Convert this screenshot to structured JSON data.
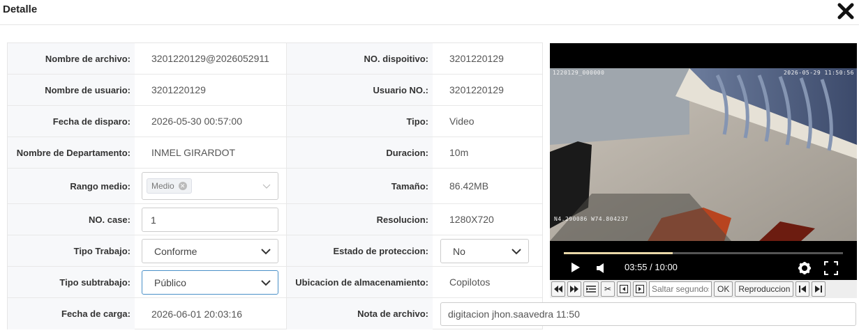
{
  "dialog": {
    "title": "Detalle",
    "close_icon": "close-icon"
  },
  "rows": [
    {
      "label1": "Nombre de archivo:",
      "value1": "3201220129@2026052911",
      "label2": "NO. dispoitivo:",
      "value2": "3201220129"
    },
    {
      "label1": "Nombre de usuario:",
      "value1": "3201220129",
      "label2": "Usuario NO.:",
      "value2": "3201220129"
    },
    {
      "label1": "Fecha de disparo:",
      "value1": "2026-05-30 00:57:00",
      "label2": "Tipo:",
      "value2": "Video"
    },
    {
      "label1": "Nombre de Departamento:",
      "value1": "INMEL GIRARDOT",
      "label2": "Duracion:",
      "value2": "10m"
    },
    {
      "label1": "Rango medio:",
      "value1_tag": "Medio",
      "label2": "Tamaño:",
      "value2": "86.42MB"
    },
    {
      "label1": "NO. case:",
      "value1_input": "1",
      "label2": "Resolucion:",
      "value2": "1280X720"
    },
    {
      "label1": "Tipo Trabajo:",
      "value1_select": "Conforme",
      "label2": "Estado de proteccion:",
      "value2_select": "No"
    },
    {
      "label1": "Tipo subtrabajo:",
      "value1_select": "Público",
      "label2": "Ubicacion de almacenamiento:",
      "value2": "Copilotos"
    },
    {
      "label1": "Fecha de carga:",
      "value1": "2026-06-01 20:03:16",
      "label2": "Nota de archivo:",
      "value2_input": "digitacion jhon.saavedra 11:50"
    }
  ],
  "video": {
    "osd_left": "1220129_000000",
    "osd_right": "2026-05-29 11:50:56",
    "gps": "N4.290086 W74.804237",
    "time": "03:55 / 10:00",
    "progress": 0.39,
    "buffered": 0.95,
    "icons": [
      "play-icon",
      "volume-icon",
      "settings-icon",
      "fullscreen-icon"
    ]
  },
  "toolbar": {
    "icons": [
      "rewind-icon",
      "fast-forward-icon",
      "list-icon",
      "scissors-icon",
      "prev-frame-icon",
      "next-frame-icon"
    ],
    "seek_placeholder": "Saltar segundos",
    "ok_label": "OK",
    "play_mode_label": "Reproduccion",
    "end_icons": [
      "skip-start-icon",
      "skip-end-icon"
    ]
  },
  "colors": {
    "accent_focus": "#4a90c8",
    "progress": "#e9d8a8",
    "label_bg": "#f7f8fa"
  }
}
